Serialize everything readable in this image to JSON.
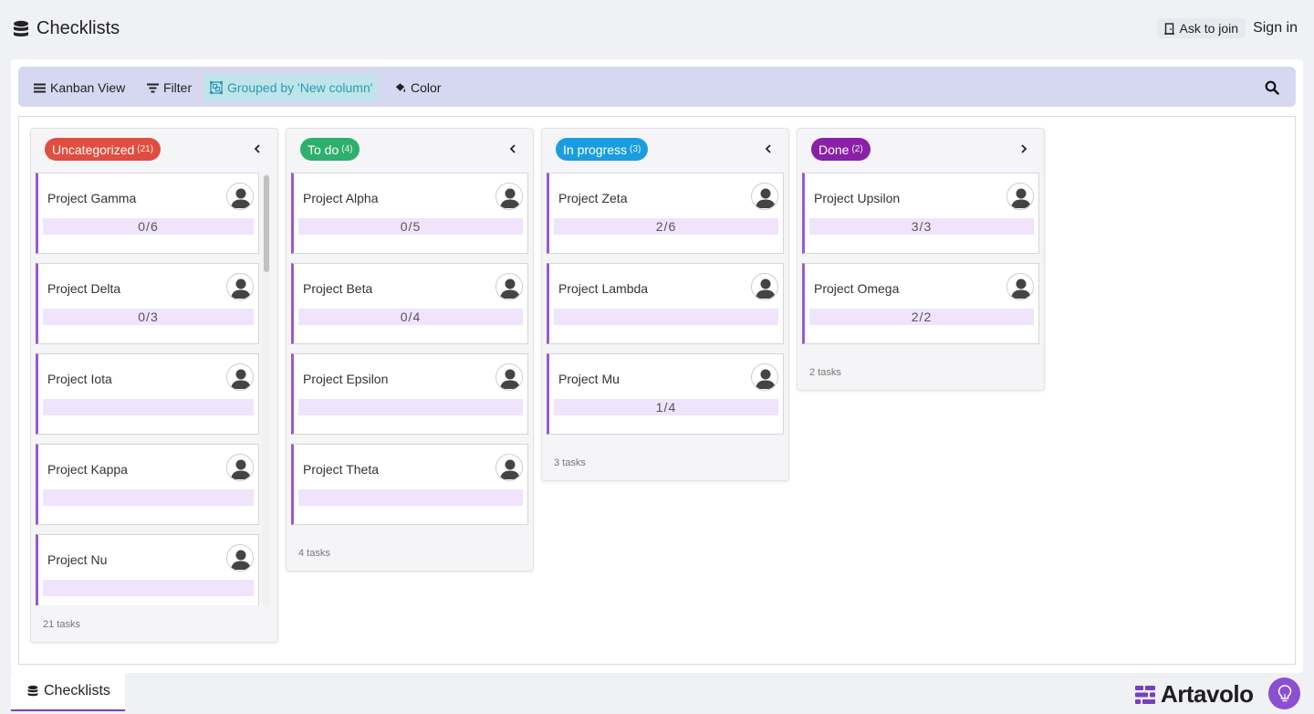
{
  "header": {
    "title": "Checklists",
    "ask_to_join": "Ask to join",
    "sign_in": "Sign in"
  },
  "toolbar": {
    "kanban_view": "Kanban View",
    "filter": "Filter",
    "grouped_by": "Grouped by 'New column'",
    "color": "Color"
  },
  "columns": [
    {
      "name": "Uncategorized",
      "count": "(21)",
      "color": "#e04e3f",
      "footer": "21 tasks",
      "cards": [
        {
          "title": "Project Gamma",
          "progress": "0/6"
        },
        {
          "title": "Project Delta",
          "progress": "0/3"
        },
        {
          "title": "Project Iota",
          "progress": ""
        },
        {
          "title": "Project Kappa",
          "progress": ""
        },
        {
          "title": "Project Nu",
          "progress": ""
        }
      ]
    },
    {
      "name": "To do",
      "count": "(4)",
      "color": "#2eaf6e",
      "footer": "4 tasks",
      "cards": [
        {
          "title": "Project Alpha",
          "progress": "0/5"
        },
        {
          "title": "Project Beta",
          "progress": "0/4"
        },
        {
          "title": "Project Epsilon",
          "progress": ""
        },
        {
          "title": "Project Theta",
          "progress": ""
        }
      ]
    },
    {
      "name": "In progress",
      "count": "(3)",
      "color": "#1a9de0",
      "footer": "3 tasks",
      "cards": [
        {
          "title": "Project Zeta",
          "progress": "2/6"
        },
        {
          "title": "Project Lambda",
          "progress": ""
        },
        {
          "title": "Project Mu",
          "progress": "1/4"
        }
      ]
    },
    {
      "name": "Done",
      "count": "(2)",
      "color": "#8a1fa8",
      "footer": "2 tasks",
      "cards": [
        {
          "title": "Project Upsilon",
          "progress": "3/3"
        },
        {
          "title": "Project Omega",
          "progress": "2/2"
        }
      ]
    }
  ],
  "bottom": {
    "tab_label": "Checklists",
    "brand": "Artavolo"
  },
  "colors": {
    "accent": "#7a3ec2",
    "card_border": "#9b59d0",
    "toolbar_bg": "#d5d8f0",
    "grouped_bg": "#bfe4ea"
  },
  "icons": {
    "db": "database-icon",
    "door": "door-icon",
    "menu": "bars-icon",
    "filter": "filter-icon",
    "group": "object-group-icon",
    "color": "paint-bucket-icon",
    "search": "search-icon",
    "avatar": "user-avatar-icon",
    "idea": "lightbulb-icon"
  }
}
